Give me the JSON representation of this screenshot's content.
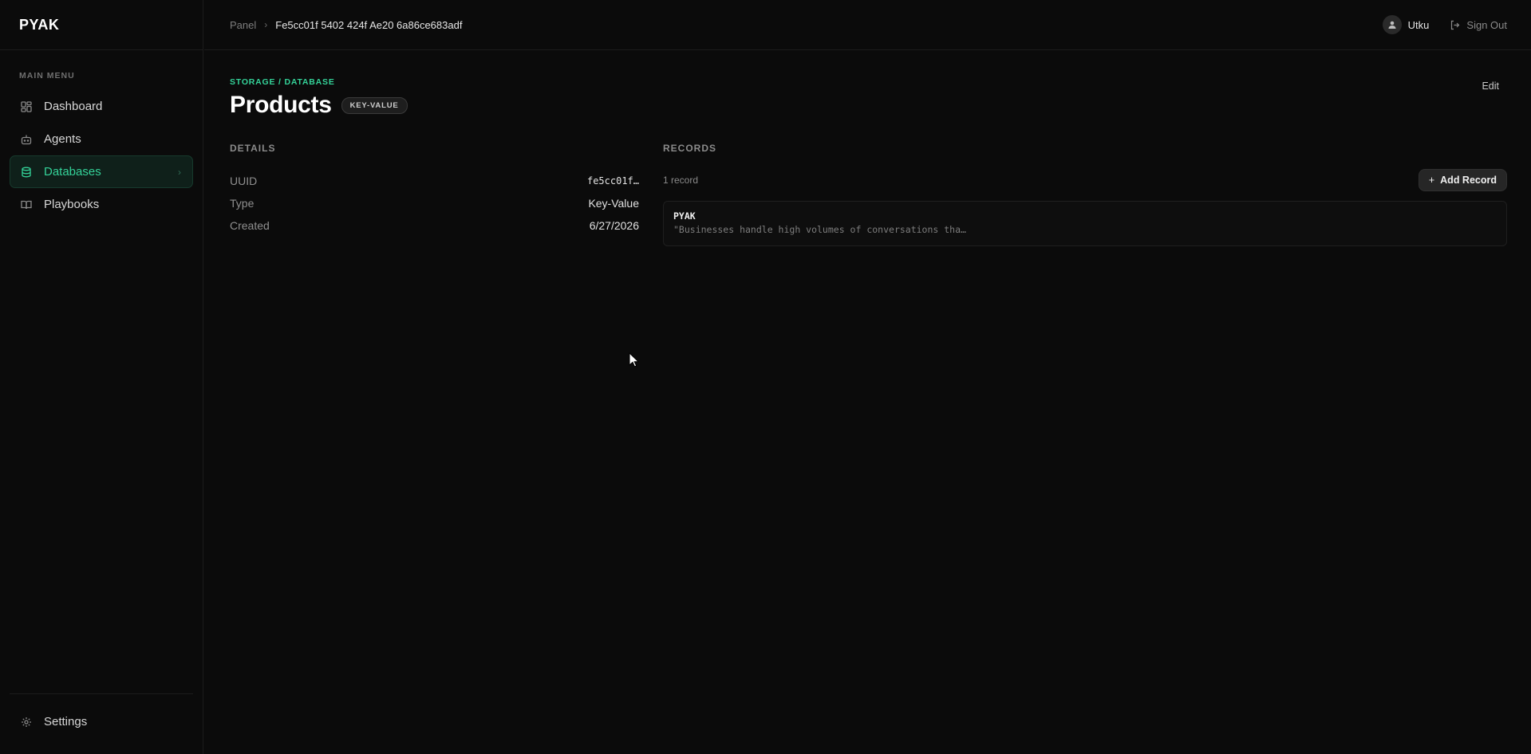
{
  "app": {
    "brand": "PYAK"
  },
  "sidebar": {
    "heading": "MAIN MENU",
    "items": [
      {
        "label": "Dashboard",
        "icon": "grid-icon",
        "active": false
      },
      {
        "label": "Agents",
        "icon": "bot-icon",
        "active": false
      },
      {
        "label": "Databases",
        "icon": "database-icon",
        "active": true
      },
      {
        "label": "Playbooks",
        "icon": "book-icon",
        "active": false
      }
    ],
    "bottom": {
      "label": "Settings",
      "icon": "gear-icon"
    }
  },
  "topbar": {
    "breadcrumb": {
      "root": "Panel",
      "current": "Fe5cc01f 5402 424f Ae20 6a86ce683adf"
    },
    "user": {
      "name": "Utku"
    },
    "signout_label": "Sign Out"
  },
  "page": {
    "kicker": "STORAGE / DATABASE",
    "title": "Products",
    "badge": "KEY-VALUE",
    "edit_label": "Edit"
  },
  "details": {
    "title": "DETAILS",
    "rows": [
      {
        "key": "UUID",
        "value": "fe5cc01f…"
      },
      {
        "key": "Type",
        "value": "Key-Value"
      },
      {
        "key": "Created",
        "value": "6/27/2026"
      }
    ]
  },
  "records": {
    "title": "RECORDS",
    "count": "1 record",
    "add_label": "Add Record",
    "items": [
      {
        "key": "PYAK",
        "value": "\"Businesses handle high volumes of conversations tha…"
      }
    ]
  },
  "colors": {
    "accent": "#34d399",
    "background": "#0b0b0b"
  }
}
